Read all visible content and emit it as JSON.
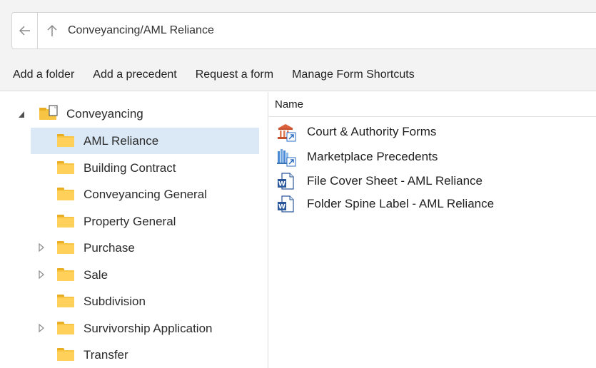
{
  "address": {
    "path": "Conveyancing/AML Reliance",
    "back_icon": "arrow-left-icon",
    "up_icon": "arrow-up-icon"
  },
  "toolbar": {
    "add_folder": "Add a folder",
    "add_precedent": "Add a precedent",
    "request_form": "Request a form",
    "manage_shortcuts": "Manage Form Shortcuts"
  },
  "tree": {
    "root": {
      "label": "Conveyancing",
      "expanded": true,
      "icon": "folder-document-icon"
    },
    "children": [
      {
        "label": "AML Reliance",
        "selected": true,
        "expandable": false
      },
      {
        "label": "Building Contract",
        "selected": false,
        "expandable": false
      },
      {
        "label": "Conveyancing General",
        "selected": false,
        "expandable": false
      },
      {
        "label": "Property General",
        "selected": false,
        "expandable": false
      },
      {
        "label": "Purchase",
        "selected": false,
        "expandable": true
      },
      {
        "label": "Sale",
        "selected": false,
        "expandable": true
      },
      {
        "label": "Subdivision",
        "selected": false,
        "expandable": false
      },
      {
        "label": "Survivorship Application",
        "selected": false,
        "expandable": true
      },
      {
        "label": "Transfer",
        "selected": false,
        "expandable": false
      }
    ]
  },
  "content": {
    "column_name": "Name",
    "items": [
      {
        "name": "Court & Authority Forms",
        "icon": "court-building-shortcut-icon"
      },
      {
        "name": "Marketplace Precedents",
        "icon": "marketplace-shortcut-icon"
      },
      {
        "name": "File Cover Sheet - AML Reliance",
        "icon": "word-document-icon"
      },
      {
        "name": "Folder Spine Label - AML Reliance",
        "icon": "word-document-icon"
      }
    ]
  },
  "colors": {
    "selection": "#dbe8f5",
    "folder": "#f7c443",
    "chrome_bg": "#f3f3f3",
    "word_blue": "#2b579a"
  }
}
